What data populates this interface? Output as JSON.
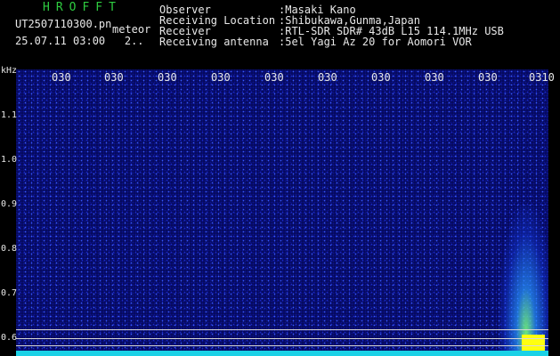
{
  "header": {
    "title": "HROFFT",
    "filename": "UT2507110300.pn",
    "meteor_label": "meteor",
    "datetime": "25.07.11 03:00",
    "value": "2..",
    "fields": [
      {
        "label": "Observer",
        "value": ":Masaki Kano"
      },
      {
        "label": "Receiving Location",
        "value": ":Shibukawa,Gunma,Japan"
      },
      {
        "label": "Receiver",
        "value": ":RTL-SDR SDR# 43dB L15 114.1MHz USB"
      },
      {
        "label": "Receiving antenna",
        "value": ":5el Yagi Az 20 for Aomori VOR"
      }
    ]
  },
  "axis": {
    "y_unit": "kHz",
    "y_ticks": [
      "1.1",
      "1.0",
      "0.9",
      "0.8",
      "0.7",
      "0.6"
    ],
    "x_ticks": [
      "030",
      "030",
      "030",
      "030",
      "030",
      "030",
      "030",
      "030",
      "030",
      "0310"
    ]
  },
  "colors": {
    "background": "#000000",
    "spectrum": "#050a5a",
    "baseline": "#1ad1e6",
    "signal": "#ffff10"
  }
}
